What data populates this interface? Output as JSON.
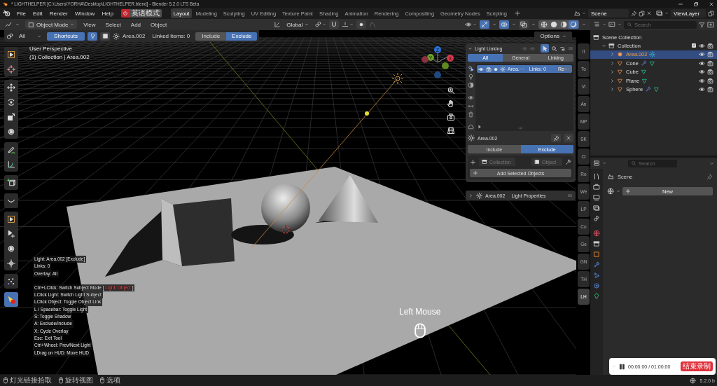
{
  "title_bar": {
    "title": "* LIGHTHELPER [C:\\Users\\YORHA\\Desktop\\LIGHTHELPER.blend] - Blender 5.2.0 LTS Beta"
  },
  "menu": [
    "File",
    "Edit",
    "Render",
    "Window",
    "Help"
  ],
  "language_button": "英语模式",
  "workspaces": [
    {
      "label": "Layout",
      "selected": true
    },
    {
      "label": "Modeling",
      "selected": false
    },
    {
      "label": "Sculpting",
      "selected": false
    },
    {
      "label": "UV Editing",
      "selected": false
    },
    {
      "label": "Texture Paint",
      "selected": false
    },
    {
      "label": "Shading",
      "selected": false
    },
    {
      "label": "Animation",
      "selected": false
    },
    {
      "label": "Rendering",
      "selected": false
    },
    {
      "label": "Compositing",
      "selected": false
    },
    {
      "label": "Geometry Nodes",
      "selected": false
    },
    {
      "label": "Scripting",
      "selected": false
    }
  ],
  "scene": "Scene",
  "view_layer": "ViewLayer",
  "viewport_header": {
    "mode": "Object Mode",
    "menus": [
      "View",
      "Select",
      "Add",
      "Object"
    ],
    "orientation": "Global",
    "toggles": [
      {
        "kind": "gizmo",
        "on": true
      },
      {
        "kind": "overlay",
        "on": true
      },
      {
        "kind": "xray",
        "on": false
      }
    ],
    "shading": [
      {
        "kind": "wireframe",
        "selected": false
      },
      {
        "kind": "solid",
        "selected": false
      },
      {
        "kind": "material",
        "selected": false
      },
      {
        "kind": "rendered",
        "selected": true
      }
    ]
  },
  "tool_header": {
    "filter": "All",
    "shortcuts": "Shortcuts",
    "light": "Area.002",
    "linked_items": "Linked items: 0",
    "modes": [
      {
        "label": "Include",
        "selected": false
      },
      {
        "label": "Exclude",
        "selected": true
      }
    ],
    "options": "Options"
  },
  "viewport": {
    "view_name": "User Perspective",
    "collection": "(1) Collection | Area.002",
    "gizmo_axes": [
      "Z",
      "Y",
      "X"
    ],
    "tool_groups": [
      [
        {
          "kind": "select",
          "selected": false
        },
        {
          "kind": "cursor",
          "selected": false
        }
      ],
      [
        {
          "kind": "move",
          "selected": false
        },
        {
          "kind": "rotate",
          "selected": false
        },
        {
          "kind": "scale",
          "selected": false
        },
        {
          "kind": "transform",
          "selected": false
        }
      ],
      [
        {
          "kind": "annotate",
          "selected": false
        },
        {
          "kind": "measure",
          "selected": false
        }
      ],
      [
        {
          "kind": "add-cube",
          "selected": false
        }
      ],
      [
        {
          "kind": "curve",
          "selected": false
        }
      ],
      [
        {
          "kind": "select",
          "selected": false
        },
        {
          "kind": "cursor-add",
          "selected": false
        },
        {
          "kind": "transform",
          "selected": false
        },
        {
          "kind": "move-dots",
          "selected": false
        }
      ],
      [
        {
          "kind": "scatter",
          "selected": false
        }
      ],
      [
        {
          "kind": "light-link",
          "selected": true
        }
      ]
    ],
    "hud_status": [
      "Light: Area.002  [Exclude]",
      "Links: 0",
      "Overlay: All"
    ],
    "hud_keys": [
      {
        "text": "Ctrl+LClick: Switch Subject Mode [",
        "highlight": "Light/ Object",
        "suffix": "]"
      },
      {
        "text": "LClick Light: Switch Light Subject"
      },
      {
        "text": "LClick Object: Toggle Object Link"
      },
      {
        "text": "L / Spacebar: Toggle Light"
      },
      {
        "text": "S: Toggle Shadow"
      },
      {
        "text": "A: Exclude/Include"
      },
      {
        "text": "X: Cycle Overlay"
      },
      {
        "text": "Esc: Exit Tool"
      },
      {
        "text": "Ctrl+Wheel: Prev/Next Light"
      },
      {
        "text": "LDrag on HUD: Move HUD"
      }
    ],
    "mouse_hint": "Left Mouse"
  },
  "light_linking": {
    "title": "Light Linking",
    "tabs": [
      {
        "label": "All",
        "selected": true
      },
      {
        "label": "General",
        "selected": false
      },
      {
        "label": "Linking",
        "selected": false
      }
    ],
    "rows": [
      {
        "name": "Area.···",
        "links": "Links: 0",
        "action": "Re···",
        "selected": true
      }
    ],
    "subject": "Area.002",
    "modes": [
      {
        "label": "Include",
        "selected": false
      },
      {
        "label": "Exclude",
        "selected": true
      }
    ],
    "collection_placeholder": "Collection",
    "object_placeholder": "Object",
    "add_button": "Add Selected Objects"
  },
  "light_properties": {
    "name": "Area.002",
    "label": "Light Properties"
  },
  "sidebar_tabs": [
    {
      "label": "It",
      "selected": false
    },
    {
      "label": "To",
      "selected": false
    },
    {
      "label": "Vi",
      "selected": false
    },
    {
      "label": "An",
      "selected": false
    },
    {
      "label": "MP",
      "selected": false
    },
    {
      "label": "SK",
      "selected": false
    },
    {
      "label": "Cl",
      "selected": false
    },
    {
      "label": "Ro",
      "selected": false
    },
    {
      "label": "We",
      "selected": false
    },
    {
      "label": "LP",
      "selected": false
    },
    {
      "label": "Co",
      "selected": false
    },
    {
      "label": "Ge",
      "selected": false
    },
    {
      "label": "GN",
      "selected": false
    },
    {
      "label": "TH",
      "selected": false
    },
    {
      "label": "LH",
      "selected": true
    }
  ],
  "outliner": {
    "search_placeholder": "Search",
    "items": [
      {
        "name": "Scene Collection",
        "kind": "scene",
        "selected": false,
        "children": [
          {
            "name": "Collection",
            "kind": "collection",
            "selected": false,
            "expanded": true,
            "children": [
              {
                "name": "Area.002",
                "kind": "light",
                "selected": true,
                "modifier": false
              },
              {
                "name": "Cone",
                "kind": "mesh",
                "selected": false,
                "modifier": true
              },
              {
                "name": "Cube",
                "kind": "mesh",
                "selected": false,
                "modifier": false
              },
              {
                "name": "Plane",
                "kind": "mesh",
                "selected": false,
                "modifier": false
              },
              {
                "name": "Sphere",
                "kind": "mesh",
                "selected": false,
                "modifier": true
              }
            ]
          }
        ]
      }
    ]
  },
  "properties": {
    "search_placeholder": "Search",
    "scene": "Scene",
    "world_button": "New"
  },
  "recorder": {
    "time": "00:00:00 / 01:00:00",
    "stop": "结束录制"
  },
  "status_bar": {
    "hints": [
      "灯光链接拾取",
      "旋转视图",
      "选项"
    ],
    "version": "5.2.0 b"
  }
}
